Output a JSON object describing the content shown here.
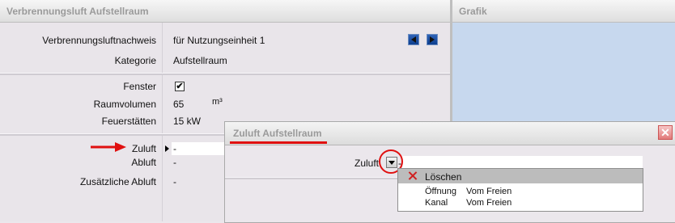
{
  "left_panel": {
    "title": "Verbrennungsluft Aufstellraum",
    "rows": [
      {
        "label": "Verbrennungsluftnachweis",
        "value": "für Nutzungseinheit 1"
      },
      {
        "label": "Kategorie",
        "value": "Aufstellraum"
      },
      {
        "label": "Fenster",
        "value": "✔"
      },
      {
        "label": "Raumvolumen",
        "value": "65",
        "unit": "m³"
      },
      {
        "label": "Feuerstätten",
        "value": "15 kW"
      },
      {
        "label": "Zuluft",
        "value": "-"
      },
      {
        "label": "Abluft",
        "value": "-"
      },
      {
        "label": "Zusätzliche Abluft",
        "value": "-"
      }
    ]
  },
  "right_panel": {
    "title": "Grafik"
  },
  "dialog": {
    "title": "Zuluft Aufstellraum",
    "field_label": "Zuluft",
    "field_value": "-",
    "close_glyph": "✕",
    "dropdown": {
      "selected": {
        "label": "Löschen"
      },
      "options": [
        {
          "label": "Öffnung",
          "detail": "Vom Freien"
        },
        {
          "label": "Kanal",
          "detail": "Vom Freien"
        }
      ]
    }
  },
  "colors": {
    "accent_red": "#e01010",
    "graphic_bg": "#c7d8ee",
    "nav_blue": "#0d3e8e"
  }
}
